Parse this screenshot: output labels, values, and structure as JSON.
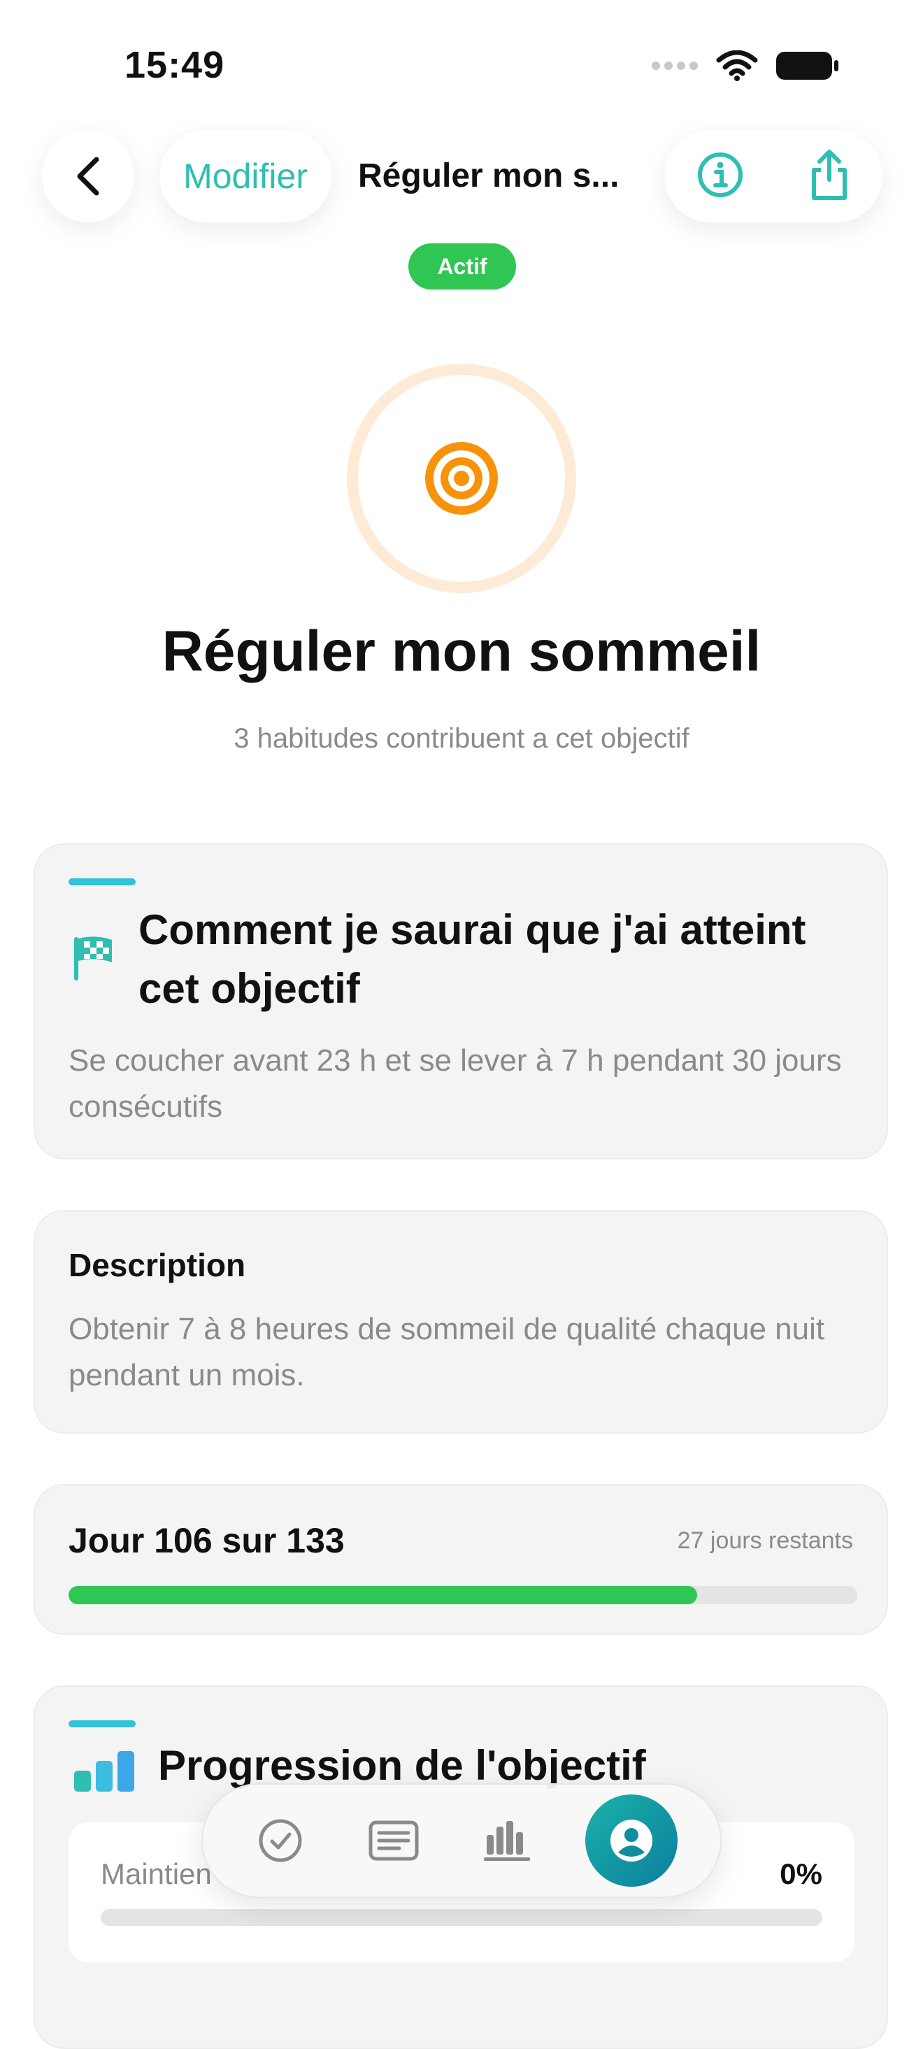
{
  "status_bar": {
    "time": "15:49"
  },
  "nav": {
    "edit_label": "Modifier",
    "title": "Réguler mon s...",
    "status_badge": "Actif"
  },
  "hero": {
    "title": "Réguler mon sommeil",
    "subtitle": "3 habitudes contribuent a cet objectif"
  },
  "success_card": {
    "title": "Comment je saurai que j'ai atteint cet objectif",
    "text": "Se coucher avant 23 h et se lever à 7 h pendant 30 jours consécutifs"
  },
  "description_card": {
    "title": "Description",
    "text": "Obtenir 7 à 8 heures de sommeil de qualité chaque nuit pendant un mois."
  },
  "day_card": {
    "title": "Jour 106 sur 133",
    "remaining": "27 jours restants",
    "progress_fraction": 0.797
  },
  "progress_card": {
    "title": "Progression de l'objectif",
    "item_label": "Maintien",
    "item_value": "0%"
  },
  "colors": {
    "accent": "#2dbfb2",
    "success": "#2fc653",
    "target_orange": "#f7930a"
  },
  "tabs": [
    "check-icon",
    "list-icon",
    "stats-icon",
    "profile-icon"
  ]
}
